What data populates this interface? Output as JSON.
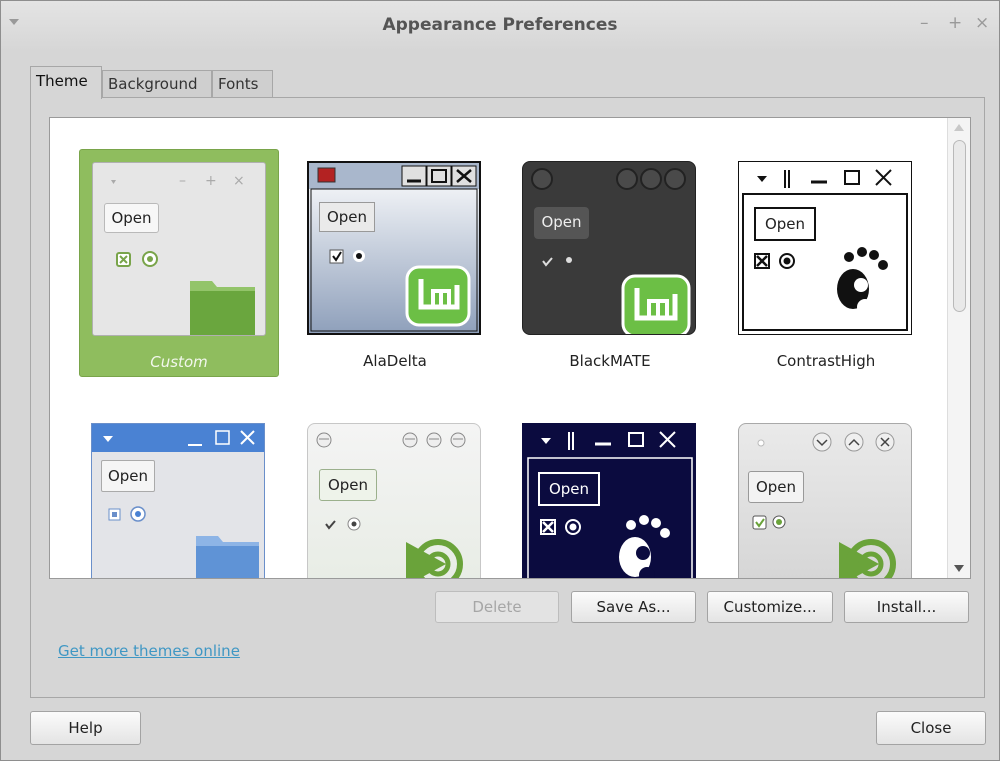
{
  "window": {
    "title": "Appearance Preferences"
  },
  "titlebar_buttons": {
    "minimize": "–",
    "maximize": "+",
    "close": "×"
  },
  "tabs": [
    {
      "label": "Theme",
      "active": true
    },
    {
      "label": "Background",
      "active": false
    },
    {
      "label": "Fonts",
      "active": false
    }
  ],
  "themes": [
    {
      "name": "Custom",
      "selected": true,
      "preview_button": "Open"
    },
    {
      "name": "AlaDelta",
      "selected": false,
      "preview_button": "Open"
    },
    {
      "name": "BlackMATE",
      "selected": false,
      "preview_button": "Open"
    },
    {
      "name": "ContrastHigh",
      "selected": false,
      "preview_button": "Open"
    },
    {
      "name": "",
      "selected": false,
      "preview_button": "Open"
    },
    {
      "name": "",
      "selected": false,
      "preview_button": "Open"
    },
    {
      "name": "",
      "selected": false,
      "preview_button": "Open"
    },
    {
      "name": "",
      "selected": false,
      "preview_button": "Open"
    }
  ],
  "actions": {
    "delete": "Delete",
    "save_as": "Save As...",
    "customize": "Customize...",
    "install": "Install..."
  },
  "link": "Get more themes online",
  "footer": {
    "help": "Help",
    "close": "Close"
  },
  "colors": {
    "selection": "#8fbd5e",
    "link": "#3f97c4",
    "mint_green": "#6cbf45"
  }
}
